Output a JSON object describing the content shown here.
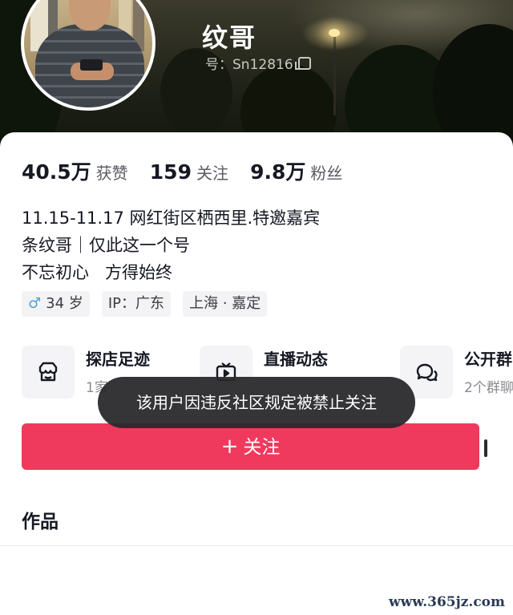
{
  "header": {
    "name": "纹哥",
    "id_text": "号：Sn12816"
  },
  "stats": [
    {
      "value": "40.5万",
      "label": "获赞"
    },
    {
      "value": "159",
      "label": "关注"
    },
    {
      "value": "9.8万",
      "label": "粉丝"
    }
  ],
  "bio": [
    "11.15-11.17 网红街区栖西里.特邀嘉宾",
    "条纹哥｜仅此这一个号",
    "不忘初心   方得始终"
  ],
  "tags": {
    "age": "34 岁",
    "ip": "IP：广东",
    "location": "上海 · 嘉定"
  },
  "features": [
    {
      "title": "探店足迹",
      "subtitle": "1家",
      "icon": "shop-icon"
    },
    {
      "title": "直播动态",
      "subtitle": "",
      "icon": "tv-icon"
    },
    {
      "title": "公开群",
      "subtitle": "2个群聊",
      "icon": "chat-icon"
    }
  ],
  "toast": "该用户因违反社区规定被禁止关注",
  "follow_button": {
    "plus": "+",
    "label": "关注"
  },
  "works_title": "作品",
  "watermark": "www.365jz.com",
  "colors": {
    "follow_button": "#ef3a5d",
    "male_icon": "#4aa3d8",
    "toast_bg": "#28282c"
  }
}
